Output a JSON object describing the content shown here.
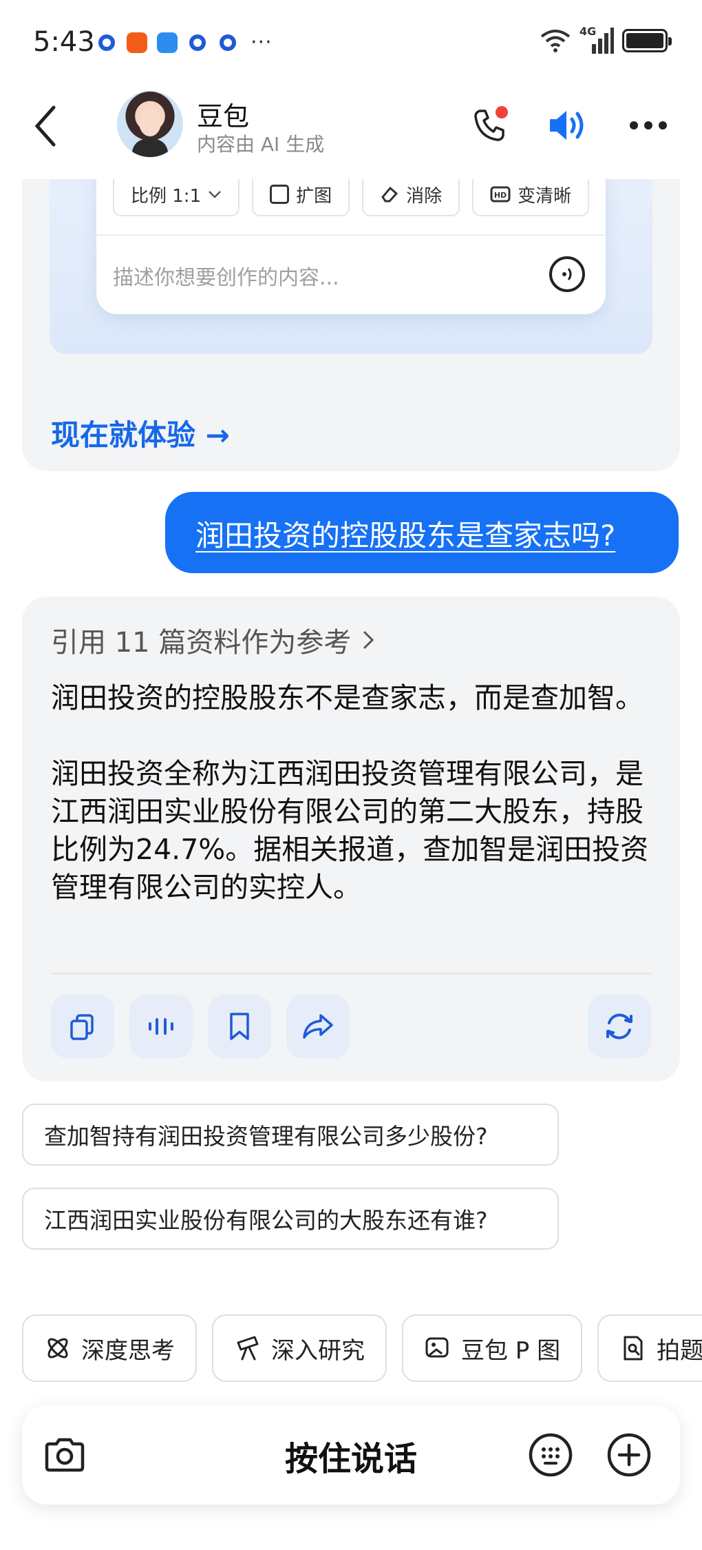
{
  "status_bar": {
    "time": "5:43",
    "dots": "···",
    "network": "4G"
  },
  "header": {
    "bot_name": "豆包",
    "bot_subtitle": "内容由 AI 生成"
  },
  "promo": {
    "chips": [
      "比例 1:1",
      "扩图",
      "消除",
      "变清晰"
    ],
    "input_placeholder": "描述你想要创作的内容...",
    "cta": "现在就体验 →"
  },
  "user_message": "润田投资的控股股东是查家志吗?",
  "answer": {
    "refs": "引用 11 篇资料作为参考",
    "paragraphs": [
      "润田投资的控股股东不是查家志，而是查加智。",
      "润田投资全称为江西润田投资管理有限公司，是江西润田实业股份有限公司的第二大股东，持股比例为24.7%。据相关报道，查加智是润田投资管理有限公司的实控人。"
    ]
  },
  "suggestions": [
    "查加智持有润田投资管理有限公司多少股份?",
    "江西润田实业股份有限公司的大股东还有谁?"
  ],
  "tools": [
    "深度思考",
    "深入研究",
    "豆包 P 图",
    "拍题"
  ],
  "input_bar": {
    "hold_to_talk": "按住说话"
  },
  "colors": {
    "accent": "#1671f5",
    "cta": "#1668e8",
    "card_bg": "#f3f4f6",
    "alert_dot": "#f0443a"
  }
}
